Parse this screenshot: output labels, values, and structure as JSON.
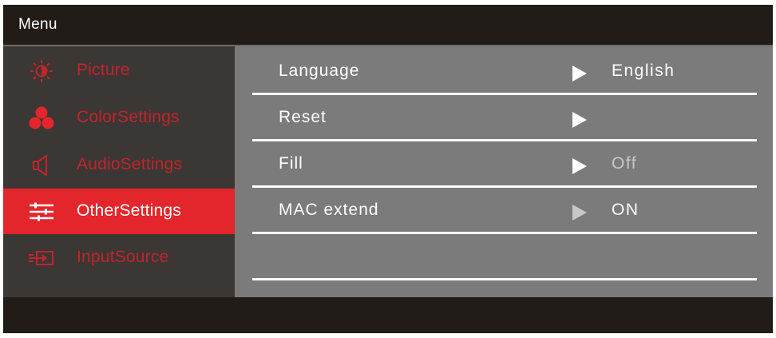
{
  "window": {
    "title": "Menu"
  },
  "colors": {
    "accent": "#e3262b",
    "background": "#221c18",
    "sidebar": "#3b3735",
    "panel": "#7b7b7b"
  },
  "sidebar": {
    "items": [
      {
        "label": "Picture",
        "icon": "brightness-icon",
        "active": false
      },
      {
        "label": "ColorSettings",
        "icon": "color-spheres-icon",
        "active": false
      },
      {
        "label": "AudioSettings",
        "icon": "speaker-icon",
        "active": false
      },
      {
        "label": "OtherSettings",
        "icon": "sliders-icon",
        "active": true
      },
      {
        "label": "InputSource",
        "icon": "input-icon",
        "active": false
      }
    ]
  },
  "settings": {
    "rows": [
      {
        "name": "Language",
        "value": "English"
      },
      {
        "name": "Reset",
        "value": ""
      },
      {
        "name": "Fill",
        "value": "Off"
      },
      {
        "name": "MAC extend",
        "value": "ON"
      },
      {
        "name": "",
        "value": ""
      }
    ]
  }
}
